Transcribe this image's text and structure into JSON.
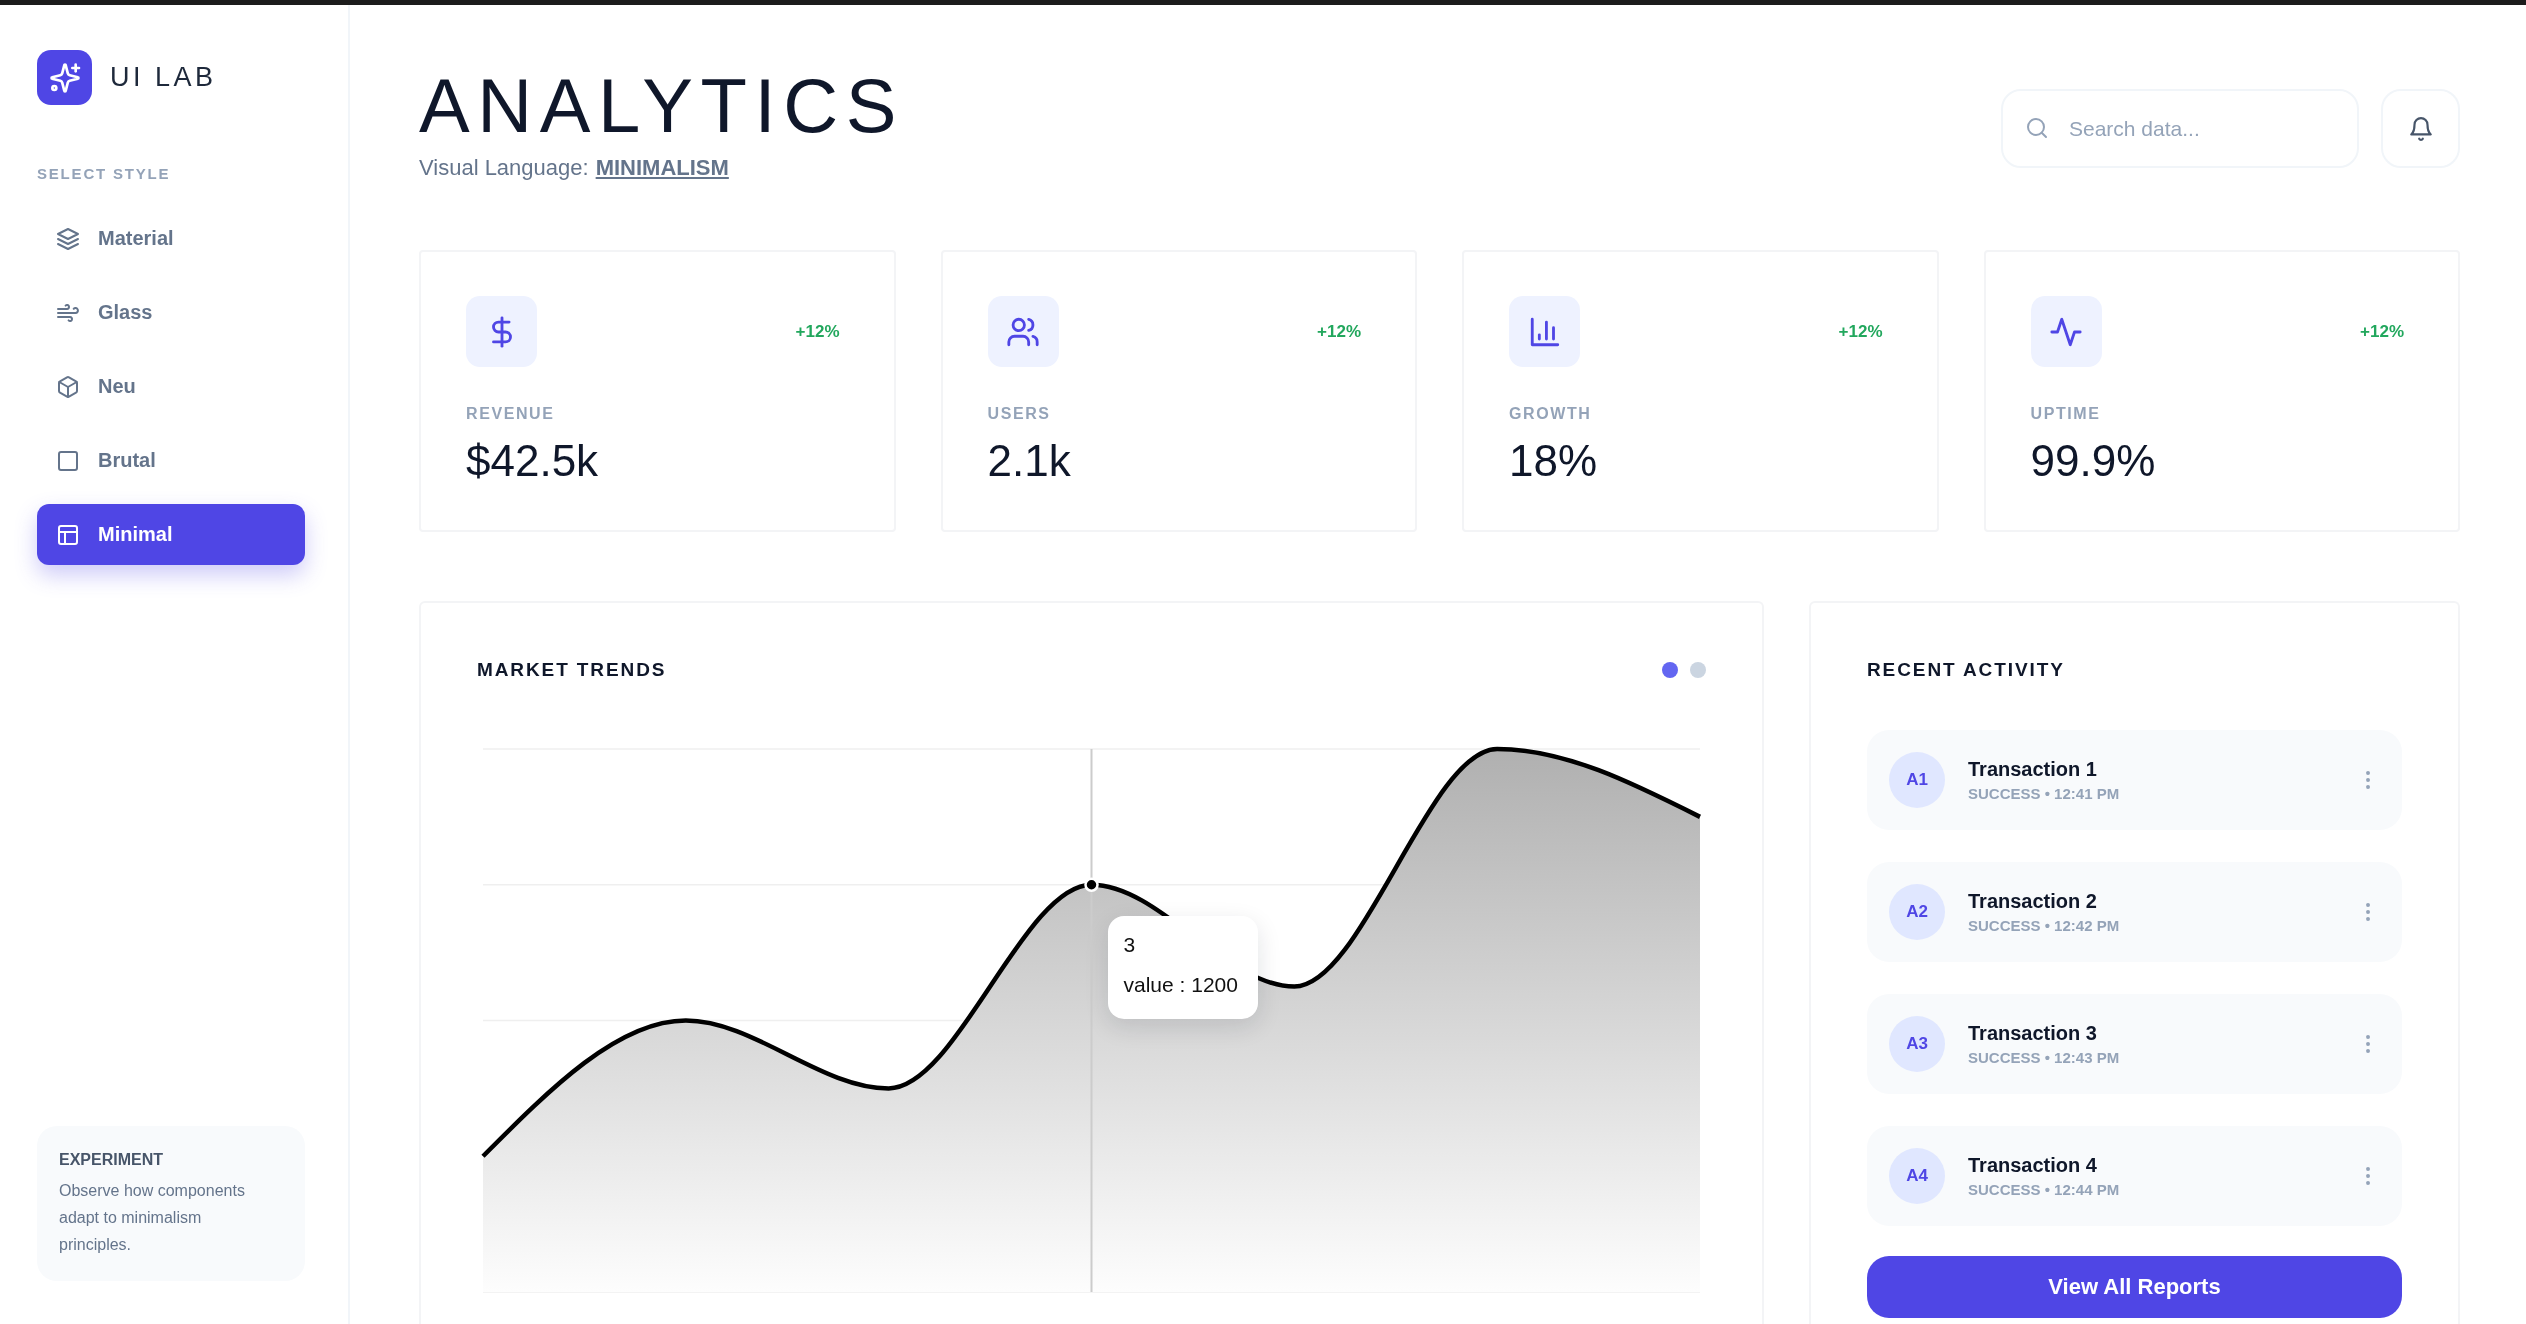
{
  "sidebar": {
    "brand": "UI LAB",
    "section_label": "SELECT STYLE",
    "items": [
      {
        "label": "Material",
        "selected": false
      },
      {
        "label": "Glass",
        "selected": false
      },
      {
        "label": "Neu",
        "selected": false
      },
      {
        "label": "Brutal",
        "selected": false
      },
      {
        "label": "Minimal",
        "selected": true
      }
    ],
    "note": {
      "title": "EXPERIMENT",
      "text": "Observe how components adapt to minimalism principles."
    }
  },
  "header": {
    "title": "ANALYTICS",
    "caption": "Visual Language:",
    "style_link": "MINIMALISM",
    "search": {
      "placeholder": "Search data..."
    }
  },
  "stats": [
    {
      "label": "REVENUE",
      "value": "$42.5k",
      "change": "+12%"
    },
    {
      "label": "USERS",
      "value": "2.1k",
      "change": "+12%"
    },
    {
      "label": "GROWTH",
      "value": "18%",
      "change": "+12%"
    },
    {
      "label": "UPTIME",
      "value": "99.9%",
      "change": "+12%"
    }
  ],
  "market": {
    "title": "MARKET TRENDS",
    "indicators": [
      {
        "color": "#6366f1"
      },
      {
        "color": "#cbd5e1"
      }
    ],
    "tooltip": {
      "title": "3",
      "text": "value : 1200"
    }
  },
  "activity": {
    "title": "RECENT ACTIVITY",
    "items": [
      {
        "avatar": "A1",
        "title": "Transaction 1",
        "meta": "SUCCESS • 12:41 PM"
      },
      {
        "avatar": "A2",
        "title": "Transaction 2",
        "meta": "SUCCESS • 12:42 PM"
      },
      {
        "avatar": "A3",
        "title": "Transaction 3",
        "meta": "SUCCESS • 12:43 PM"
      },
      {
        "avatar": "A4",
        "title": "Transaction 4",
        "meta": "SUCCESS • 12:44 PM"
      }
    ],
    "button": "View All Reports"
  }
}
